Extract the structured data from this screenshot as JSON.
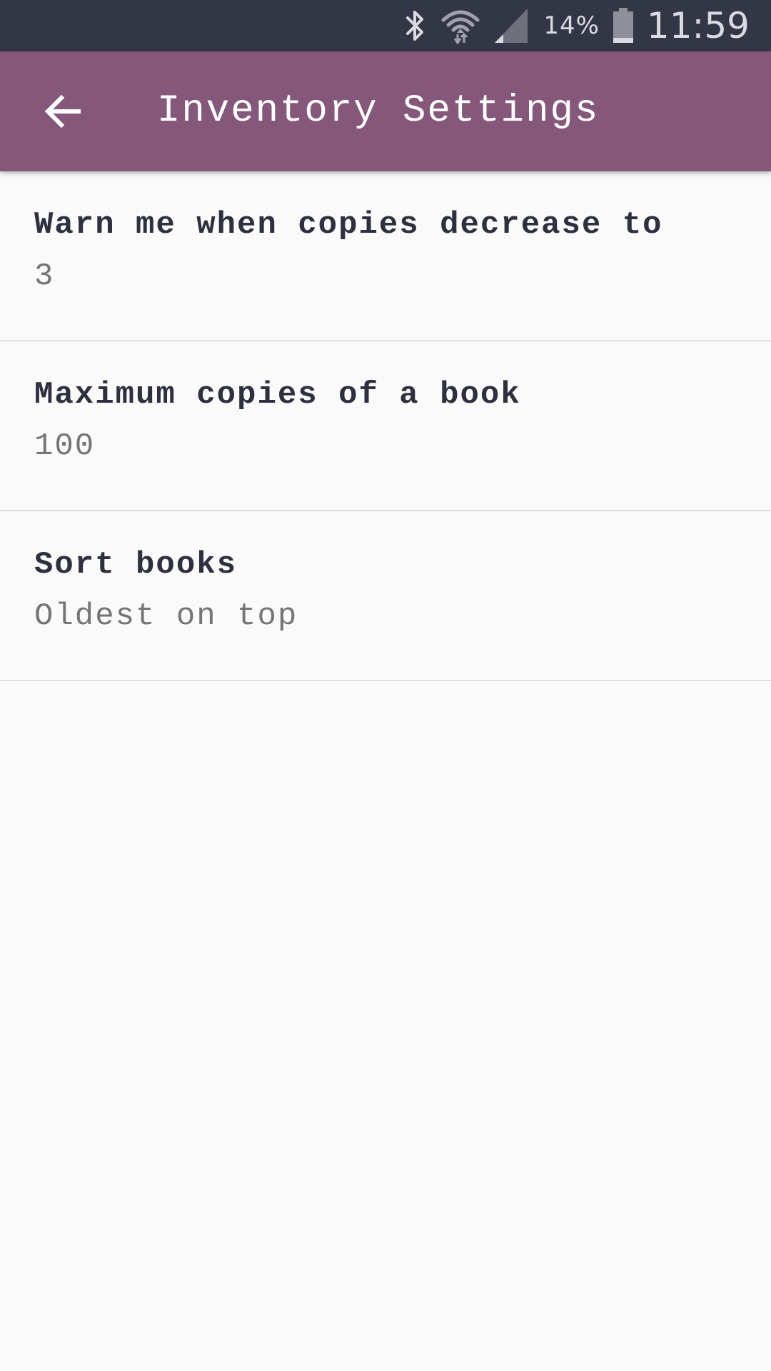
{
  "status_bar": {
    "battery_percent": "14%",
    "time": "11:59",
    "icons": [
      "bluetooth-icon",
      "wifi-icon",
      "cell-signal-icon",
      "battery-icon"
    ],
    "background_color": "#333645"
  },
  "app_bar": {
    "title": "Inventory Settings",
    "back_icon": "arrow-back-icon",
    "background_color": "#85587b"
  },
  "settings": {
    "items": [
      {
        "title": "Warn me when copies decrease to",
        "value": "3"
      },
      {
        "title": "Maximum copies of a book",
        "value": "100"
      },
      {
        "title": "Sort books",
        "value": "Oldest on top"
      }
    ]
  }
}
